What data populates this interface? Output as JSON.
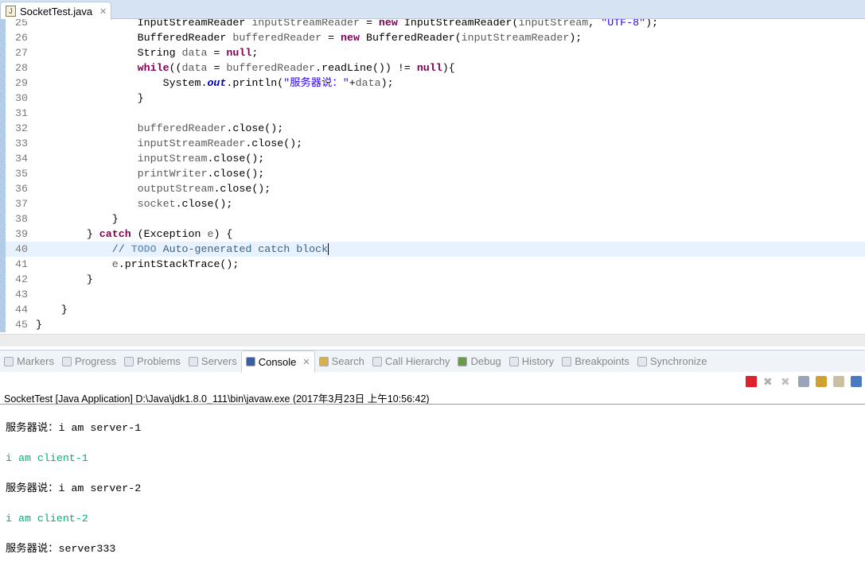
{
  "editor": {
    "tab_label": "SocketTest.java",
    "file_icon": "java-file-icon",
    "lines": [
      {
        "n": "25",
        "tokens": [
          [
            "                InputStreamReader ",
            ""
          ],
          [
            "inputStreamReader",
            "var"
          ],
          [
            " = ",
            ""
          ],
          [
            "new",
            "kw"
          ],
          [
            " InputStreamReader(",
            ""
          ],
          [
            "inputStream",
            "var"
          ],
          [
            ", ",
            ""
          ],
          [
            "\"UTF-8\"",
            "str"
          ],
          [
            ");",
            ""
          ]
        ]
      },
      {
        "n": "26",
        "tokens": [
          [
            "                BufferedReader ",
            ""
          ],
          [
            "bufferedReader",
            "var"
          ],
          [
            " = ",
            ""
          ],
          [
            "new",
            "kw"
          ],
          [
            " BufferedReader(",
            ""
          ],
          [
            "inputStreamReader",
            "var"
          ],
          [
            ");",
            ""
          ]
        ]
      },
      {
        "n": "27",
        "tokens": [
          [
            "                String ",
            ""
          ],
          [
            "data",
            "var"
          ],
          [
            " = ",
            ""
          ],
          [
            "null",
            "kw"
          ],
          [
            ";",
            ""
          ]
        ]
      },
      {
        "n": "28",
        "tokens": [
          [
            "                ",
            ""
          ],
          [
            "while",
            "kw"
          ],
          [
            "((",
            ""
          ],
          [
            "data",
            "var"
          ],
          [
            " = ",
            ""
          ],
          [
            "bufferedReader",
            "var"
          ],
          [
            ".readLine()) != ",
            ""
          ],
          [
            "null",
            "kw"
          ],
          [
            "){",
            ""
          ]
        ]
      },
      {
        "n": "29",
        "tokens": [
          [
            "                    System.",
            ""
          ],
          [
            "out",
            "fld"
          ],
          [
            ".println(",
            ""
          ],
          [
            "\"服务器说：\"",
            "str"
          ],
          [
            "+",
            ""
          ],
          [
            "data",
            "var"
          ],
          [
            ");",
            ""
          ]
        ]
      },
      {
        "n": "30",
        "tokens": [
          [
            "                }",
            ""
          ]
        ]
      },
      {
        "n": "31",
        "tokens": []
      },
      {
        "n": "32",
        "tokens": [
          [
            "                ",
            ""
          ],
          [
            "bufferedReader",
            "var"
          ],
          [
            ".close();",
            ""
          ]
        ]
      },
      {
        "n": "33",
        "tokens": [
          [
            "                ",
            ""
          ],
          [
            "inputStreamReader",
            "var"
          ],
          [
            ".close();",
            ""
          ]
        ]
      },
      {
        "n": "34",
        "tokens": [
          [
            "                ",
            ""
          ],
          [
            "inputStream",
            "var"
          ],
          [
            ".close();",
            ""
          ]
        ]
      },
      {
        "n": "35",
        "tokens": [
          [
            "                ",
            ""
          ],
          [
            "printWriter",
            "var"
          ],
          [
            ".close();",
            ""
          ]
        ]
      },
      {
        "n": "36",
        "tokens": [
          [
            "                ",
            ""
          ],
          [
            "outputStream",
            "var"
          ],
          [
            ".close();",
            ""
          ]
        ]
      },
      {
        "n": "37",
        "tokens": [
          [
            "                ",
            ""
          ],
          [
            "socket",
            "var"
          ],
          [
            ".close();",
            ""
          ]
        ]
      },
      {
        "n": "38",
        "tokens": [
          [
            "            }",
            ""
          ]
        ]
      },
      {
        "n": "39",
        "tokens": [
          [
            "        } ",
            ""
          ],
          [
            "catch",
            "kw"
          ],
          [
            " (Exception ",
            ""
          ],
          [
            "e",
            "var"
          ],
          [
            ") {",
            ""
          ]
        ]
      },
      {
        "n": "40",
        "tokens": [
          [
            "            ",
            ""
          ],
          [
            "// ",
            "cm"
          ],
          [
            "TODO",
            "todo"
          ],
          [
            " Auto-generated catch block",
            "cm"
          ]
        ],
        "current": true
      },
      {
        "n": "41",
        "tokens": [
          [
            "            ",
            ""
          ],
          [
            "e",
            "var"
          ],
          [
            ".printStackTrace();",
            ""
          ]
        ]
      },
      {
        "n": "42",
        "tokens": [
          [
            "        }",
            ""
          ]
        ]
      },
      {
        "n": "43",
        "tokens": []
      },
      {
        "n": "44",
        "tokens": [
          [
            "    }",
            ""
          ]
        ]
      },
      {
        "n": "45",
        "tokens": [
          [
            "}",
            ""
          ]
        ]
      }
    ]
  },
  "panel": {
    "tabs": [
      {
        "label": "Markers",
        "icon": "markers-icon"
      },
      {
        "label": "Progress",
        "icon": "progress-icon"
      },
      {
        "label": "Problems",
        "icon": "problems-icon"
      },
      {
        "label": "Servers",
        "icon": "servers-icon"
      },
      {
        "label": "Console",
        "icon": "console-icon",
        "active": true
      },
      {
        "label": "Search",
        "icon": "search-icon"
      },
      {
        "label": "Call Hierarchy",
        "icon": "call-hierarchy-icon"
      },
      {
        "label": "Debug",
        "icon": "debug-icon"
      },
      {
        "label": "History",
        "icon": "history-icon"
      },
      {
        "label": "Breakpoints",
        "icon": "breakpoints-icon"
      },
      {
        "label": "Synchronize",
        "icon": "synchronize-icon"
      }
    ],
    "toolbar": [
      "terminate-icon",
      "remove-launch-icon",
      "remove-all-launches-icon",
      "clear-console-icon",
      "scroll-lock-icon",
      "word-wrap-icon",
      "display-console-icon"
    ],
    "title": "SocketTest [Java Application] D:\\Java\\jdk1.8.0_111\\bin\\javaw.exe (2017年3月23日 上午10:56:42)",
    "output": [
      {
        "text": "服务器说：i am server-1",
        "type": "out"
      },
      {
        "text": "i am client-1",
        "type": "in"
      },
      {
        "text": "服务器说：i am server-2",
        "type": "out"
      },
      {
        "text": "i am client-2",
        "type": "in"
      },
      {
        "text": "服务器说：server333",
        "type": "out"
      }
    ]
  },
  "colors": {
    "keyword": "#7f0055",
    "string": "#2a00ff",
    "comment": "#3f5f7f",
    "stdin": "#00b07a",
    "terminate": "#e0202a"
  }
}
